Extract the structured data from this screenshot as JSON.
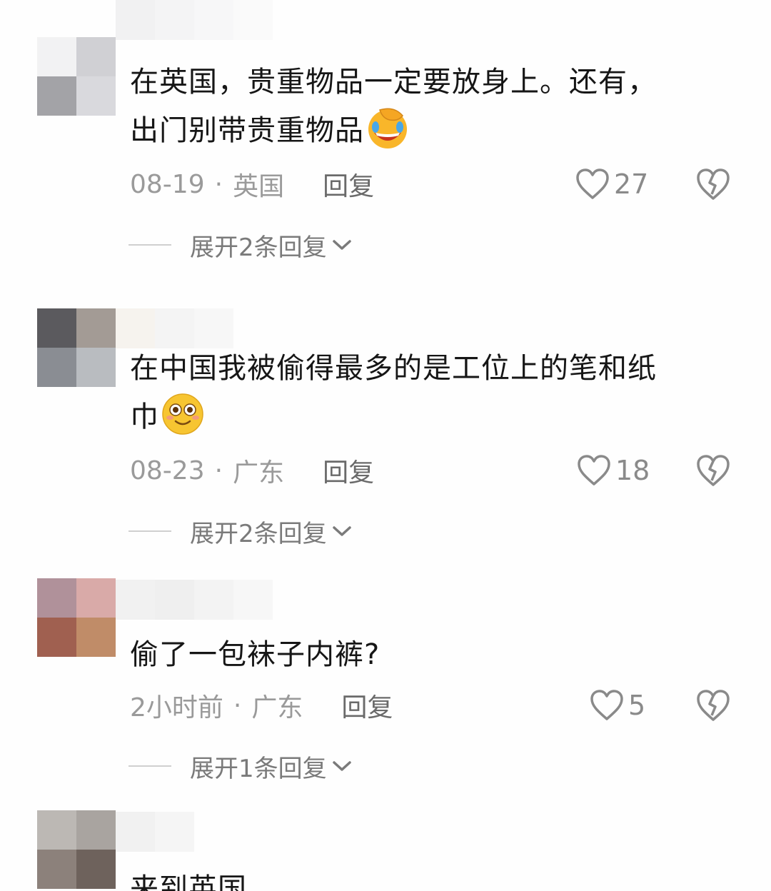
{
  "comments": [
    {
      "text_lines": [
        "在英国，贵重物品一定要放身上。还有，",
        "出门别带贵重物品"
      ],
      "emoji": "facepalm-laughing-emoji",
      "date": "08-19",
      "location": "英国",
      "reply_label": "回复",
      "likes": "27",
      "expand_label": "展开2条回复",
      "avatar_colors": [
        "#f2f2f3",
        "#d0d0d4",
        "#a3a3a7",
        "#d9d9dd"
      ]
    },
    {
      "text_lines": [
        "在中国我被偷得最多的是工位上的笔和纸",
        "巾"
      ],
      "emoji": "smiling-emoji",
      "date": "08-23",
      "location": "广东",
      "reply_label": "回复",
      "likes": "18",
      "expand_label": "展开2条回复",
      "avatar_colors": [
        "#5b5a5e",
        "#a39b95",
        "#8a8d93",
        "#b9bcc0"
      ]
    },
    {
      "text_lines": [
        "偷了一包袜子内裤?"
      ],
      "emoji": "",
      "date": "2小时前",
      "location": "广东",
      "reply_label": "回复",
      "likes": "5",
      "expand_label": "展开1条回复",
      "avatar_colors": [
        "#b0919a",
        "#d9aaa8",
        "#a06050",
        "#c08c68"
      ]
    },
    {
      "text_lines": [
        "来到英国……"
      ],
      "avatar_colors": [
        "#bcb8b4",
        "#a9a4a0",
        "#8c817b",
        "#6e625c"
      ]
    }
  ],
  "separator_dot": "·",
  "icons": {
    "like": "heart-outline-icon",
    "dislike": "broken-heart-icon",
    "expand": "chevron-down-icon"
  }
}
